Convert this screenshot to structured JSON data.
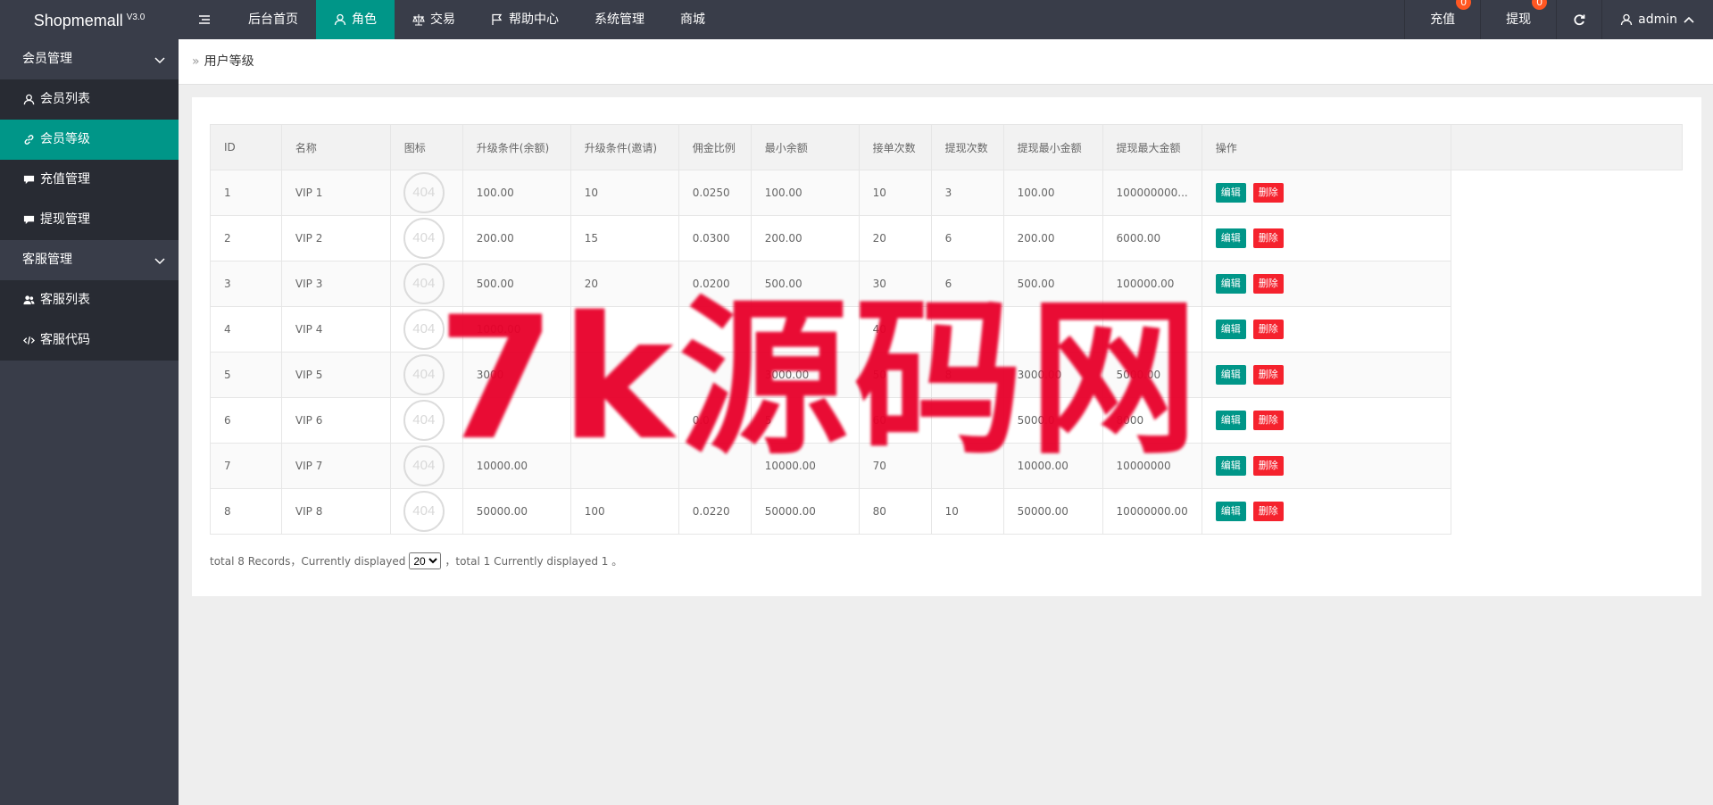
{
  "header": {
    "logo": "Shopmemall",
    "version": "V3.0",
    "menu_toggle_icon": "menu-fold-icon",
    "nav": [
      {
        "label": "后台首页",
        "icon": null,
        "active": false
      },
      {
        "label": "角色",
        "icon": "user-icon",
        "active": true
      },
      {
        "label": "交易",
        "icon": "scale-icon",
        "active": false
      },
      {
        "label": "帮助中心",
        "icon": "flag-icon",
        "active": false
      },
      {
        "label": "系统管理",
        "icon": null,
        "active": false
      },
      {
        "label": "商城",
        "icon": null,
        "active": false
      }
    ],
    "recharge": {
      "label": "充值",
      "badge": "0"
    },
    "withdraw": {
      "label": "提现",
      "badge": "0"
    },
    "refresh_icon": "refresh-icon",
    "user": {
      "label": "admin",
      "icon": "user-icon"
    }
  },
  "sidebar": {
    "groups": [
      {
        "label": "会员管理",
        "items": [
          {
            "label": "会员列表",
            "icon": "user-icon",
            "active": false
          },
          {
            "label": "会员等级",
            "icon": "link-icon",
            "active": true
          },
          {
            "label": "充值管理",
            "icon": "comment-icon",
            "active": false
          },
          {
            "label": "提现管理",
            "icon": "comment-icon",
            "active": false
          }
        ]
      },
      {
        "label": "客服管理",
        "items": [
          {
            "label": "客服列表",
            "icon": "users-icon",
            "active": false
          },
          {
            "label": "客服代码",
            "icon": "code-icon",
            "active": false
          }
        ]
      }
    ]
  },
  "breadcrumb": {
    "sep": "»",
    "current": "用户等级"
  },
  "table": {
    "headers": [
      "ID",
      "名称",
      "图标",
      "升级条件(余额)",
      "升级条件(邀请)",
      "佣金比例",
      "最小余额",
      "接单次数",
      "提现次数",
      "提现最小金额",
      "提现最大金额",
      "操作"
    ],
    "icon_placeholder": "404",
    "edit_label": "编辑",
    "delete_label": "删除",
    "rows": [
      [
        "1",
        "VIP 1",
        "100.00",
        "10",
        "0.0250",
        "100.00",
        "10",
        "3",
        "100.00",
        "100000000..."
      ],
      [
        "2",
        "VIP 2",
        "200.00",
        "15",
        "0.0300",
        "200.00",
        "20",
        "6",
        "200.00",
        "6000.00"
      ],
      [
        "3",
        "VIP 3",
        "500.00",
        "20",
        "0.0200",
        "500.00",
        "30",
        "6",
        "500.00",
        "100000.00"
      ],
      [
        "4",
        "VIP 4",
        "1000.00",
        "",
        "",
        "",
        "40",
        "",
        "",
        ""
      ],
      [
        "5",
        "VIP 5",
        "3000",
        "",
        "",
        "3000.00",
        "50",
        "8",
        "3000.00",
        "5000.00"
      ],
      [
        "6",
        "VIP 6",
        "",
        "",
        "0.0",
        "5",
        "60",
        "",
        "5000.0",
        "8000"
      ],
      [
        "7",
        "VIP 7",
        "10000.00",
        "",
        "",
        "10000.00",
        "70",
        "",
        "10000.00",
        "10000000"
      ],
      [
        "8",
        "VIP 8",
        "50000.00",
        "100",
        "0.0220",
        "50000.00",
        "80",
        "10",
        "50000.00",
        "10000000.00"
      ]
    ]
  },
  "pager": {
    "prefix": "total 8 Records，Currently displayed",
    "page_size": "20",
    "suffix": "，total 1 Currently displayed 1 。"
  },
  "watermark": "7k源码网"
}
